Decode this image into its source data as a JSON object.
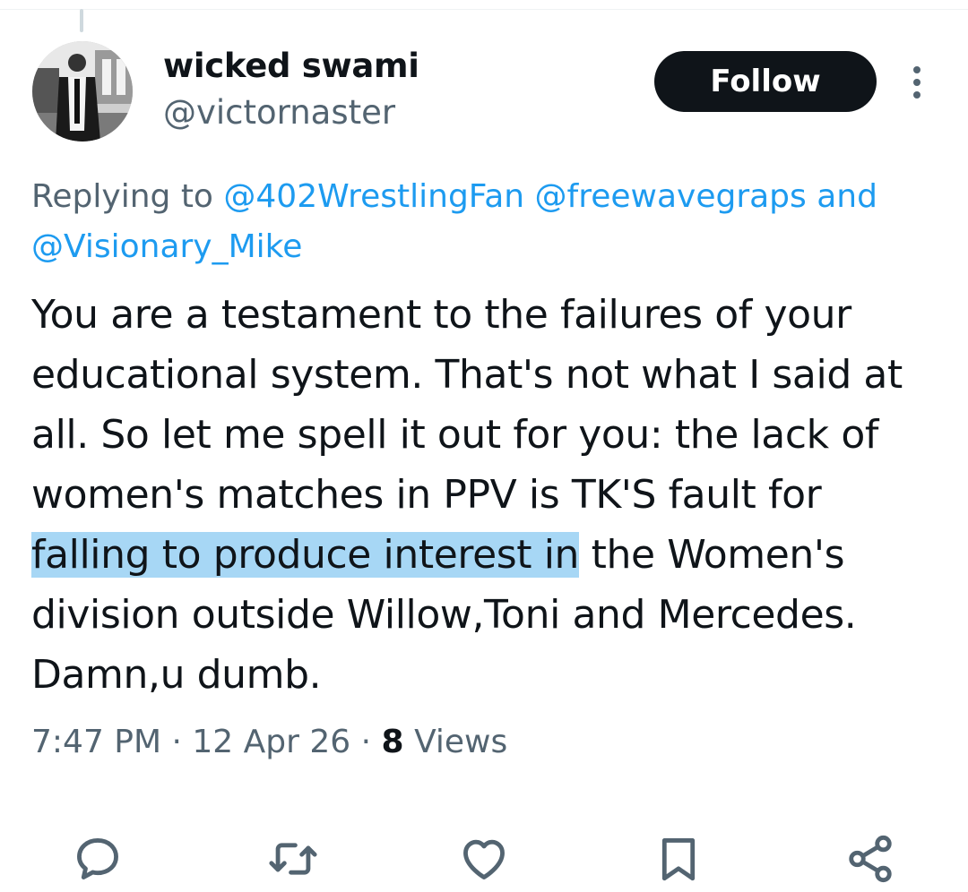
{
  "author": {
    "display_name": "wicked swami",
    "handle": "@victornaster",
    "follow_label": "Follow"
  },
  "reply": {
    "prefix": "Replying to ",
    "mentions": [
      "@402WrestlingFan",
      "@freewavegraps"
    ],
    "conjunction": " and ",
    "last_mention": "@Visionary_Mike"
  },
  "tweet": {
    "text_before": "You are a testament to the failures of your educational system. That's not what I said at all. So let me spell it out for you: the lack of women's matches in PPV is TK'S fault for ",
    "text_highlighted": "falling to produce interest in",
    "text_after": " the Women's division outside Willow,Toni and Mercedes. Damn,u dumb."
  },
  "meta": {
    "time": "7:47 PM",
    "date": "12 Apr 26",
    "views_count": "8",
    "views_label": "Views",
    "separator": " · "
  },
  "actions": [
    "reply-icon",
    "retweet-icon",
    "like-icon",
    "bookmark-icon",
    "share-icon"
  ],
  "colors": {
    "link": "#1d9bf0",
    "secondary_text": "#536471",
    "primary_text": "#0f1419",
    "highlight": "#a7d7f5"
  }
}
